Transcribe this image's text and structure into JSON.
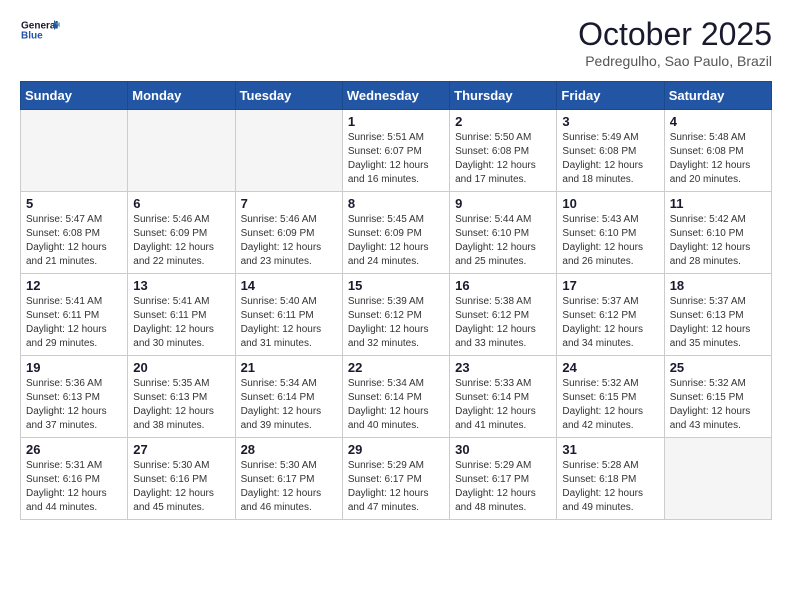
{
  "header": {
    "logo_line1": "General",
    "logo_line2": "Blue",
    "month": "October 2025",
    "location": "Pedregulho, Sao Paulo, Brazil"
  },
  "weekdays": [
    "Sunday",
    "Monday",
    "Tuesday",
    "Wednesday",
    "Thursday",
    "Friday",
    "Saturday"
  ],
  "weeks": [
    [
      {
        "day": "",
        "detail": ""
      },
      {
        "day": "",
        "detail": ""
      },
      {
        "day": "",
        "detail": ""
      },
      {
        "day": "1",
        "detail": "Sunrise: 5:51 AM\nSunset: 6:07 PM\nDaylight: 12 hours\nand 16 minutes."
      },
      {
        "day": "2",
        "detail": "Sunrise: 5:50 AM\nSunset: 6:08 PM\nDaylight: 12 hours\nand 17 minutes."
      },
      {
        "day": "3",
        "detail": "Sunrise: 5:49 AM\nSunset: 6:08 PM\nDaylight: 12 hours\nand 18 minutes."
      },
      {
        "day": "4",
        "detail": "Sunrise: 5:48 AM\nSunset: 6:08 PM\nDaylight: 12 hours\nand 20 minutes."
      }
    ],
    [
      {
        "day": "5",
        "detail": "Sunrise: 5:47 AM\nSunset: 6:08 PM\nDaylight: 12 hours\nand 21 minutes."
      },
      {
        "day": "6",
        "detail": "Sunrise: 5:46 AM\nSunset: 6:09 PM\nDaylight: 12 hours\nand 22 minutes."
      },
      {
        "day": "7",
        "detail": "Sunrise: 5:46 AM\nSunset: 6:09 PM\nDaylight: 12 hours\nand 23 minutes."
      },
      {
        "day": "8",
        "detail": "Sunrise: 5:45 AM\nSunset: 6:09 PM\nDaylight: 12 hours\nand 24 minutes."
      },
      {
        "day": "9",
        "detail": "Sunrise: 5:44 AM\nSunset: 6:10 PM\nDaylight: 12 hours\nand 25 minutes."
      },
      {
        "day": "10",
        "detail": "Sunrise: 5:43 AM\nSunset: 6:10 PM\nDaylight: 12 hours\nand 26 minutes."
      },
      {
        "day": "11",
        "detail": "Sunrise: 5:42 AM\nSunset: 6:10 PM\nDaylight: 12 hours\nand 28 minutes."
      }
    ],
    [
      {
        "day": "12",
        "detail": "Sunrise: 5:41 AM\nSunset: 6:11 PM\nDaylight: 12 hours\nand 29 minutes."
      },
      {
        "day": "13",
        "detail": "Sunrise: 5:41 AM\nSunset: 6:11 PM\nDaylight: 12 hours\nand 30 minutes."
      },
      {
        "day": "14",
        "detail": "Sunrise: 5:40 AM\nSunset: 6:11 PM\nDaylight: 12 hours\nand 31 minutes."
      },
      {
        "day": "15",
        "detail": "Sunrise: 5:39 AM\nSunset: 6:12 PM\nDaylight: 12 hours\nand 32 minutes."
      },
      {
        "day": "16",
        "detail": "Sunrise: 5:38 AM\nSunset: 6:12 PM\nDaylight: 12 hours\nand 33 minutes."
      },
      {
        "day": "17",
        "detail": "Sunrise: 5:37 AM\nSunset: 6:12 PM\nDaylight: 12 hours\nand 34 minutes."
      },
      {
        "day": "18",
        "detail": "Sunrise: 5:37 AM\nSunset: 6:13 PM\nDaylight: 12 hours\nand 35 minutes."
      }
    ],
    [
      {
        "day": "19",
        "detail": "Sunrise: 5:36 AM\nSunset: 6:13 PM\nDaylight: 12 hours\nand 37 minutes."
      },
      {
        "day": "20",
        "detail": "Sunrise: 5:35 AM\nSunset: 6:13 PM\nDaylight: 12 hours\nand 38 minutes."
      },
      {
        "day": "21",
        "detail": "Sunrise: 5:34 AM\nSunset: 6:14 PM\nDaylight: 12 hours\nand 39 minutes."
      },
      {
        "day": "22",
        "detail": "Sunrise: 5:34 AM\nSunset: 6:14 PM\nDaylight: 12 hours\nand 40 minutes."
      },
      {
        "day": "23",
        "detail": "Sunrise: 5:33 AM\nSunset: 6:14 PM\nDaylight: 12 hours\nand 41 minutes."
      },
      {
        "day": "24",
        "detail": "Sunrise: 5:32 AM\nSunset: 6:15 PM\nDaylight: 12 hours\nand 42 minutes."
      },
      {
        "day": "25",
        "detail": "Sunrise: 5:32 AM\nSunset: 6:15 PM\nDaylight: 12 hours\nand 43 minutes."
      }
    ],
    [
      {
        "day": "26",
        "detail": "Sunrise: 5:31 AM\nSunset: 6:16 PM\nDaylight: 12 hours\nand 44 minutes."
      },
      {
        "day": "27",
        "detail": "Sunrise: 5:30 AM\nSunset: 6:16 PM\nDaylight: 12 hours\nand 45 minutes."
      },
      {
        "day": "28",
        "detail": "Sunrise: 5:30 AM\nSunset: 6:17 PM\nDaylight: 12 hours\nand 46 minutes."
      },
      {
        "day": "29",
        "detail": "Sunrise: 5:29 AM\nSunset: 6:17 PM\nDaylight: 12 hours\nand 47 minutes."
      },
      {
        "day": "30",
        "detail": "Sunrise: 5:29 AM\nSunset: 6:17 PM\nDaylight: 12 hours\nand 48 minutes."
      },
      {
        "day": "31",
        "detail": "Sunrise: 5:28 AM\nSunset: 6:18 PM\nDaylight: 12 hours\nand 49 minutes."
      },
      {
        "day": "",
        "detail": ""
      }
    ]
  ]
}
